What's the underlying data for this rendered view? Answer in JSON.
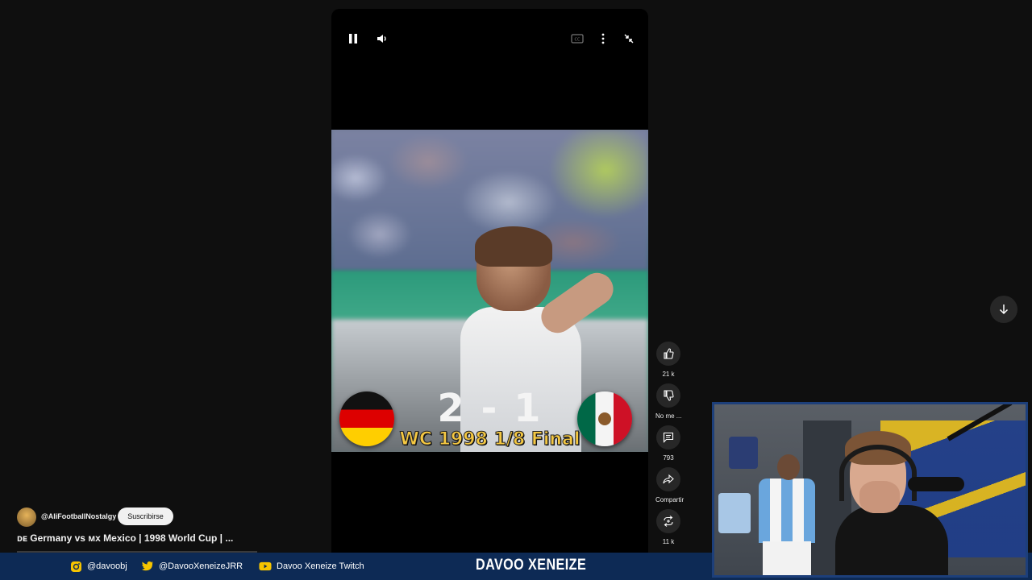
{
  "player": {
    "controls": {
      "pause_icon": "pause-icon",
      "volume_icon": "volume-icon",
      "cc_icon": "closed-captions-icon",
      "more_icon": "more-vertical-icon",
      "exit_fullscreen_icon": "exit-fullscreen-icon"
    },
    "overlay": {
      "score": "2 - 1",
      "caption": "WC 1998 1/8 Final"
    }
  },
  "actions": {
    "like_count": "21 k",
    "dislike_label": "No me ...",
    "comments_count": "793",
    "share_label": "Compartir",
    "remix_count": "11 k"
  },
  "channel": {
    "handle": "@AliFootballNostalgy",
    "subscribe_label": "Suscribirse"
  },
  "video": {
    "title": "ᴅᴇ Germany vs ᴍx Mexico | 1998 World Cup | ..."
  },
  "stream_overlay": {
    "instagram": "@davoobj",
    "twitter": "@DavooXeneizeJRR",
    "youtube": "Davoo Xeneize Twitch",
    "brand": "DAVOO XENEIZE"
  },
  "colors": {
    "background": "#0f0f0f",
    "overlay_bar": "#0d2a55",
    "caption_yellow": "#f5c842",
    "youtube_red": "#ffcc00"
  }
}
